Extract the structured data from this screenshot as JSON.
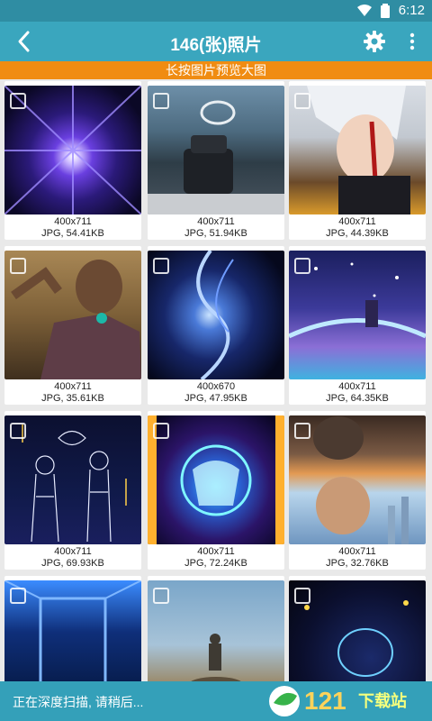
{
  "status_bar": {
    "time": "6:12"
  },
  "app_bar": {
    "title": "146(张)照片"
  },
  "hint_banner": "长按图片预览大图",
  "photos": [
    {
      "dims": "400x711",
      "info": "JPG, 54.41KB"
    },
    {
      "dims": "400x711",
      "info": "JPG, 51.94KB"
    },
    {
      "dims": "400x711",
      "info": "JPG, 44.39KB"
    },
    {
      "dims": "400x711",
      "info": "JPG, 35.61KB"
    },
    {
      "dims": "400x670",
      "info": "JPG, 47.95KB"
    },
    {
      "dims": "400x711",
      "info": "JPG, 64.35KB"
    },
    {
      "dims": "400x711",
      "info": "JPG, 69.93KB"
    },
    {
      "dims": "400x711",
      "info": "JPG, 72.24KB"
    },
    {
      "dims": "400x711",
      "info": "JPG, 32.76KB"
    },
    {
      "dims": "",
      "info": ""
    },
    {
      "dims": "",
      "info": ""
    },
    {
      "dims": "",
      "info": ""
    }
  ],
  "bottom_bar": {
    "status": "正在深度扫描, 请稍后...",
    "brand_number": "121",
    "brand_text": "下载站"
  }
}
